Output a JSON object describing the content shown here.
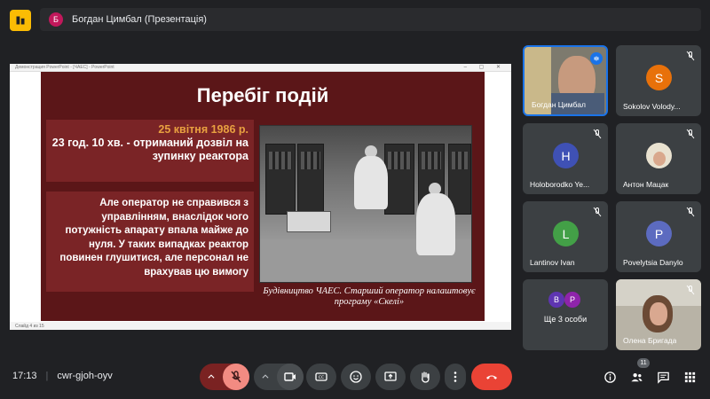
{
  "topbar": {
    "presenter_initial": "Б",
    "title": "Богдан Цимбал (Презентація)"
  },
  "window": {
    "title": "Демонстрация PowerPoint - [ЧАЕС] - PowerPoint",
    "status": "Слайд 4 из 15"
  },
  "slide": {
    "title": "Перебіг подій",
    "date": "25 квітня 1986 р.",
    "event": "23 год. 10 хв. - отриманий дозвіл на зупинку реактора",
    "body": "Але оператор не справився з управлінням, внаслідок чого потужність апарату впала майже до нуля. У таких випадках реактор повинен глушитися, але персонал не врахував цю вимогу",
    "caption": "Будівництво ЧАЕС. Старший оператор налаштовує програму «Скелі»"
  },
  "participants": [
    {
      "name": "Богдан Цимбал",
      "type": "video"
    },
    {
      "name": "Sokolov Volody...",
      "initial": "S",
      "color": "#e8710a"
    },
    {
      "name": "Holoborodko Ye...",
      "initial": "H",
      "color": "#3f51b5"
    },
    {
      "name": "Антон Мацак",
      "type": "photo"
    },
    {
      "name": "Lantinov Ivan",
      "initial": "L",
      "color": "#43a047"
    },
    {
      "name": "Povelytsia Danylo",
      "initial": "P",
      "color": "#5c6bc0"
    },
    {
      "name": "Олена Бригада",
      "type": "video"
    }
  ],
  "more": {
    "initials": [
      "В",
      "P"
    ],
    "colors": [
      "#5e35b1",
      "#8e24aa"
    ],
    "label": "Ще 3 особи"
  },
  "bottom": {
    "time": "17:13",
    "meeting_code": "cwr-gjoh-oyv",
    "participant_count": "11"
  },
  "colors": {
    "background": "#202124",
    "tile": "#3c4043",
    "end_call": "#ea4335",
    "accent": "#1a73e8",
    "slide_bg": "#5b1618"
  }
}
